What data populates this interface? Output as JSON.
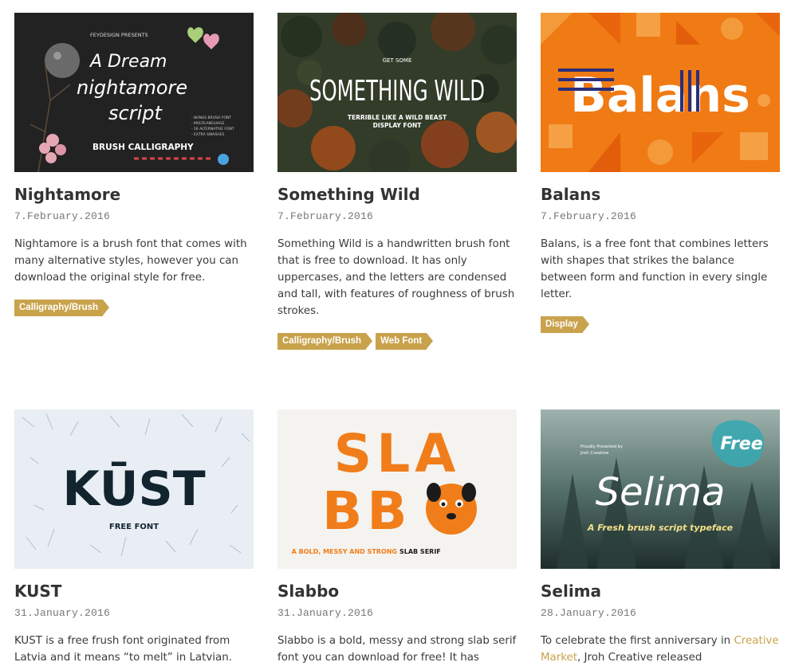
{
  "posts": [
    {
      "title": "Nightamore",
      "date": "7.February.2016",
      "description": "Nightamore is a brush font that comes with many alternative styles, however you can download the original style for free.",
      "tags": [
        "Calligraphy/Brush"
      ],
      "thumb": {
        "presents": "FEYDESIGN PRESENTS",
        "line1": "A Dream",
        "line2": "nightamore",
        "line3": "script",
        "features": [
          "- BONUS BRUSH FONT",
          "- MULTILANGUAGE",
          "- 16 ALTERNATIVE FONT",
          "- EXTRA SWASHES"
        ],
        "sub": "BRUSH CALLIGRAPHY"
      }
    },
    {
      "title": "Something Wild",
      "date": "7.February.2016",
      "description": "Something Wild is a handwritten brush font that is free to download. It has only uppercases, and the letters are condensed and tall, with features of roughness of brush strokes.",
      "tags": [
        "Calligraphy/Brush",
        "Web Font"
      ],
      "thumb": {
        "top": "GET SOME",
        "main": "SOMETHING WILD",
        "sub1": "TERRIBLE LIKE A WILD BEAST",
        "sub2": "DISPLAY FONT"
      }
    },
    {
      "title": "Balans",
      "date": "7.February.2016",
      "description": "Balans, is a free font that combines letters with shapes that strikes the balance between form and function in every single letter.",
      "tags": [
        "Display"
      ],
      "thumb": {
        "main": "Balans"
      }
    },
    {
      "title": "KUST",
      "date": "31.January.2016",
      "description": "KUST is a free frush font originated from Latvia and it means “to melt” in Latvian.",
      "tags": [],
      "thumb": {
        "main": "KŪST",
        "sub": "FREE FONT"
      }
    },
    {
      "title": "Slabbo",
      "date": "31.January.2016",
      "description": "Slabbo is a bold, messy and strong slab serif font you can download for free! It has",
      "tags": [],
      "thumb": {
        "line1": "SLA",
        "line2": "BB",
        "caption_orange": "A BOLD, MESSY AND STRONG",
        "caption_dark": "SLAB SERIF"
      }
    },
    {
      "title": "Selima",
      "date": "28.January.2016",
      "description_before": "To celebrate the first anniversary in",
      "description_link": "Creative Market",
      "description_after": ", Jroh Creative released",
      "tags": [],
      "thumb": {
        "badge": "Free",
        "proud1": "Proudly Presented by",
        "proud2": "Jroh Creative",
        "main": "Selima",
        "sub": "A Fresh brush script typeface"
      }
    }
  ],
  "colors": {
    "tag": "#c9a24c",
    "link": "#c8a24a",
    "title": "#333333"
  }
}
